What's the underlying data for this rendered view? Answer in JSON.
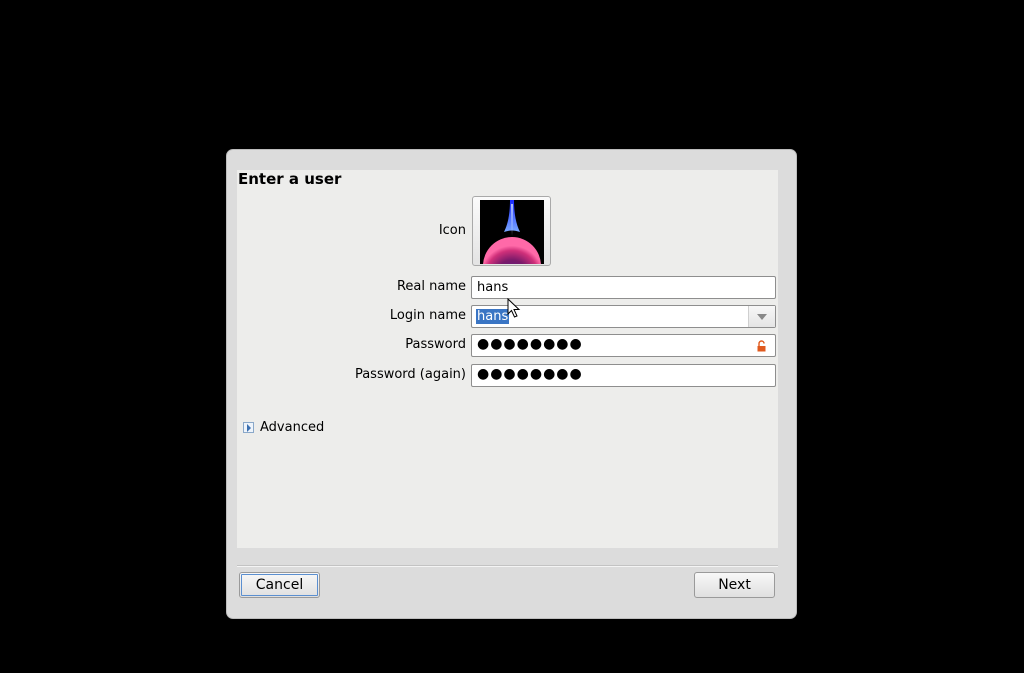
{
  "dialog": {
    "title": "Enter a user",
    "icon_label": "Icon",
    "real_name": {
      "label": "Real name",
      "value": "hans"
    },
    "login_name": {
      "label": "Login name",
      "value": "hans"
    },
    "password": {
      "label": "Password",
      "value": "●●●●●●●●"
    },
    "password_again": {
      "label": "Password (again)",
      "value": "●●●●●●●●"
    },
    "advanced_label": "Advanced",
    "cancel_label": "Cancel",
    "next_label": "Next"
  },
  "colors": {
    "selection": "#3a75c4",
    "lock": "#e05a1e"
  },
  "icons": {
    "expander": "triangle-right-icon",
    "lock": "lock-open-icon",
    "avatar": "plasma-globe-avatar"
  }
}
